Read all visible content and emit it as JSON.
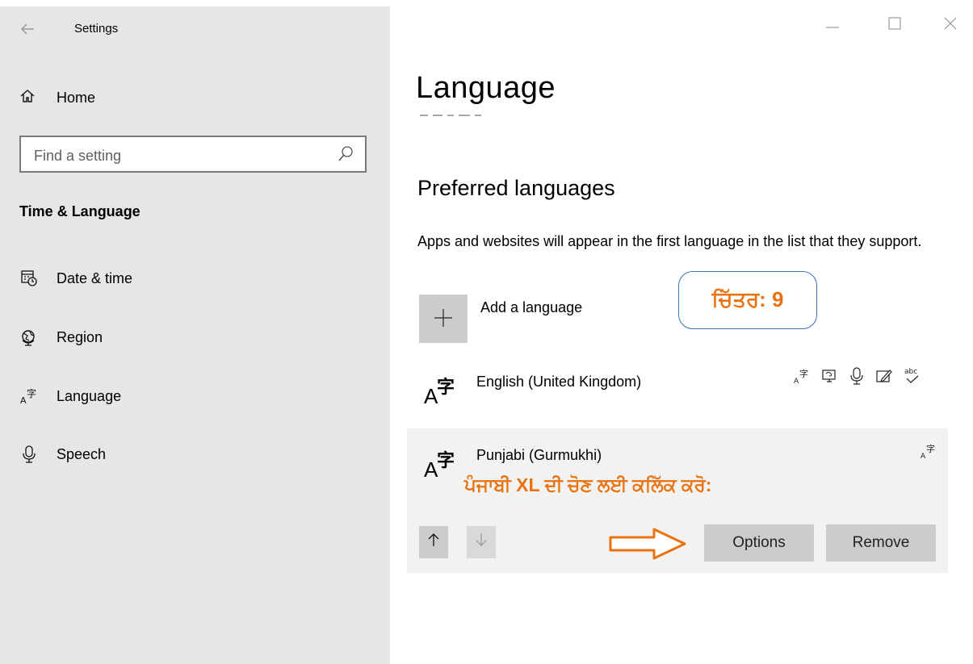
{
  "window": {
    "title": "Settings",
    "back_icon": "back-arrow-icon",
    "controls": [
      "minimize-icon",
      "maximize-icon",
      "close-icon"
    ]
  },
  "sidebar": {
    "home_label": "Home",
    "search_placeholder": "Find a setting",
    "section_title": "Time & Language",
    "items": [
      {
        "label": "Date & time",
        "icon": "calendar-clock-icon"
      },
      {
        "label": "Region",
        "icon": "globe-icon"
      },
      {
        "label": "Language",
        "icon": "language-icon"
      },
      {
        "label": "Speech",
        "icon": "microphone-icon"
      }
    ]
  },
  "main": {
    "title": "Language",
    "section_title": "Preferred languages",
    "description": "Apps and websites will appear in the first language in the list that they support.",
    "add_language_label": "Add a language",
    "languages": [
      {
        "name": "English (United Kingdom)",
        "features": [
          "language-pack-icon",
          "display-language-icon",
          "speech-icon",
          "handwriting-icon",
          "spelling-icon"
        ]
      },
      {
        "name": "Punjabi (Gurmukhi)",
        "features": [
          "language-pack-icon"
        ]
      }
    ],
    "options_label": "Options",
    "remove_label": "Remove"
  },
  "annotations": {
    "callout": "ਚਿੱਤਰ: 9",
    "instruction": "ਪੰਜਾਬੀ XL ਦੀ ਚੋਣ ਲਈ ਕਲਿੱਕ ਕਰੋ:",
    "accent_color": "#e87310"
  }
}
